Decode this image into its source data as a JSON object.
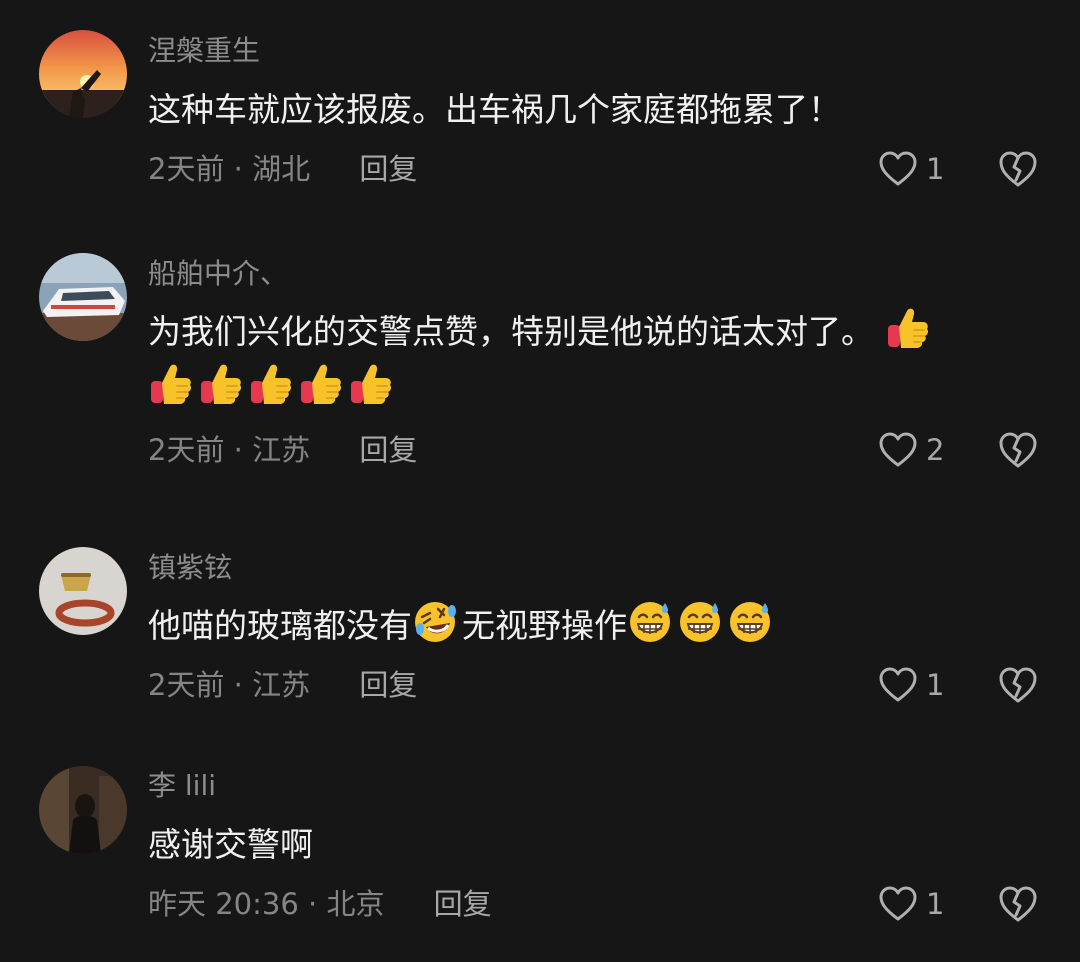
{
  "comments": [
    {
      "username": "涅槃重生",
      "text": "这种车就应该报废。出车祸几个家庭都拖累了！",
      "time_location": "2天前 · 湖北",
      "reply_label": "回复",
      "like_count": "1"
    },
    {
      "username": "船舶中介、",
      "text": "为我们兴化的交警点赞，特别是他说的话太对了。",
      "time_location": "2天前 · 江苏",
      "reply_label": "回复",
      "like_count": "2"
    },
    {
      "username": "镇紫铉",
      "text_a": "他喵的玻璃都没有",
      "text_b": "无视野操作",
      "time_location": "2天前 · 江苏",
      "reply_label": "回复",
      "like_count": "1"
    },
    {
      "username": "李 lili",
      "text": "感谢交警啊",
      "time_location": "昨天 20:36 · 北京",
      "reply_label": "回复",
      "like_count": "1"
    }
  ],
  "icons": {
    "like": "heart-outline-icon",
    "dislike": "broken-heart-icon",
    "thumbs_up": "thumbs-up-emoji",
    "rofl": "rolling-laughing-emoji",
    "sweat_grin": "grinning-sweat-emoji"
  },
  "colors": {
    "background": "#161616",
    "text_primary": "#f0f0f0",
    "text_secondary": "#858585",
    "emoji_yellow": "#f8c32a",
    "emoji_red": "#e8384f"
  }
}
